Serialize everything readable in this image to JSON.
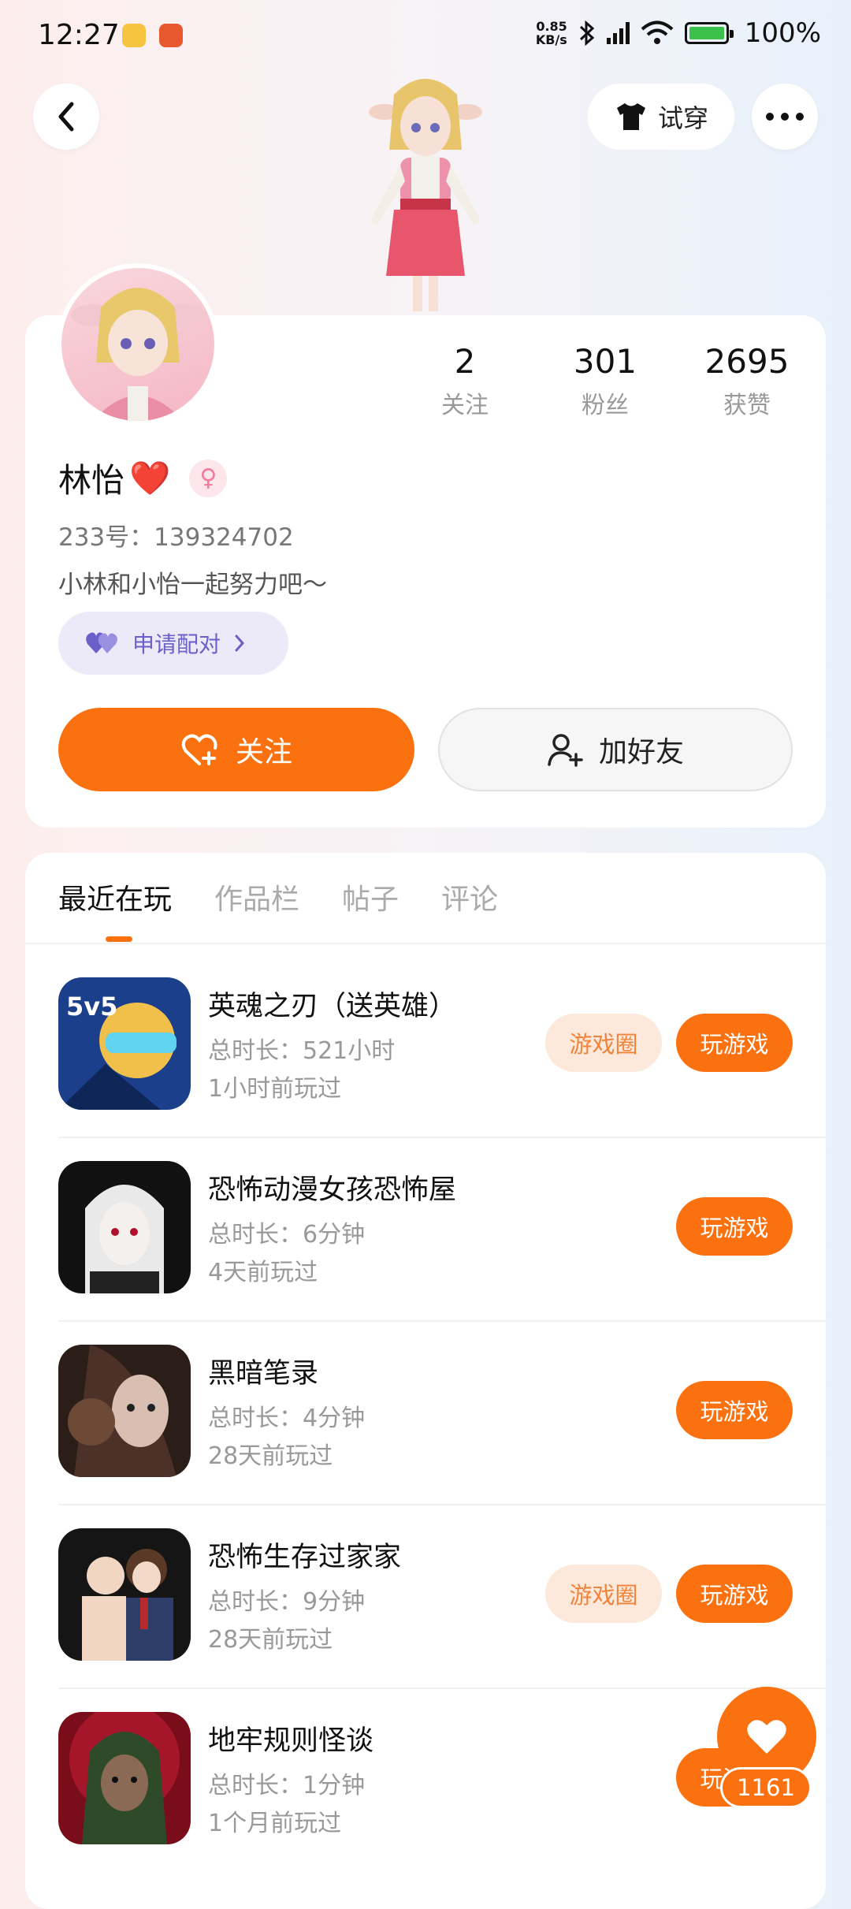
{
  "status_bar": {
    "time": "12:27",
    "net_speed_value": "0.85",
    "net_speed_unit": "KB/s",
    "battery": "100%"
  },
  "header": {
    "tryon_label": "试穿"
  },
  "profile": {
    "stats": [
      {
        "value": "2",
        "label": "关注"
      },
      {
        "value": "301",
        "label": "粉丝"
      },
      {
        "value": "2695",
        "label": "获赞"
      }
    ],
    "name": "林怡",
    "name_emoji": "❤️",
    "uid": "233号：139324702",
    "bio": "小林和小怡一起努力吧～",
    "pair_label": "申请配对",
    "follow_label": "关注",
    "add_friend_label": "加好友"
  },
  "tabs": [
    {
      "label": "最近在玩"
    },
    {
      "label": "作品栏"
    },
    {
      "label": "帖子"
    },
    {
      "label": "评论"
    }
  ],
  "games": [
    {
      "title": "英魂之刃（送英雄）",
      "duration": "总时长：521小时",
      "last_played": "1小时前玩过",
      "circle_label": "游戏圈",
      "play_label": "玩游戏"
    },
    {
      "title": "恐怖动漫女孩恐怖屋",
      "duration": "总时长：6分钟",
      "last_played": "4天前玩过",
      "play_label": "玩游戏"
    },
    {
      "title": "黑暗笔录",
      "duration": "总时长：4分钟",
      "last_played": "28天前玩过",
      "play_label": "玩游戏"
    },
    {
      "title": "恐怖生存过家家",
      "duration": "总时长：9分钟",
      "last_played": "28天前玩过",
      "circle_label": "游戏圈",
      "play_label": "玩游戏"
    },
    {
      "title": "地牢规则怪谈",
      "duration": "总时长：1分钟",
      "last_played": "1个月前玩过",
      "play_label": "玩游戏"
    }
  ],
  "float_like": {
    "count": "1161"
  },
  "colors": {
    "accent": "#fb7110",
    "pair_bg": "#ece9f9",
    "pair_text": "#6b5fc9"
  }
}
